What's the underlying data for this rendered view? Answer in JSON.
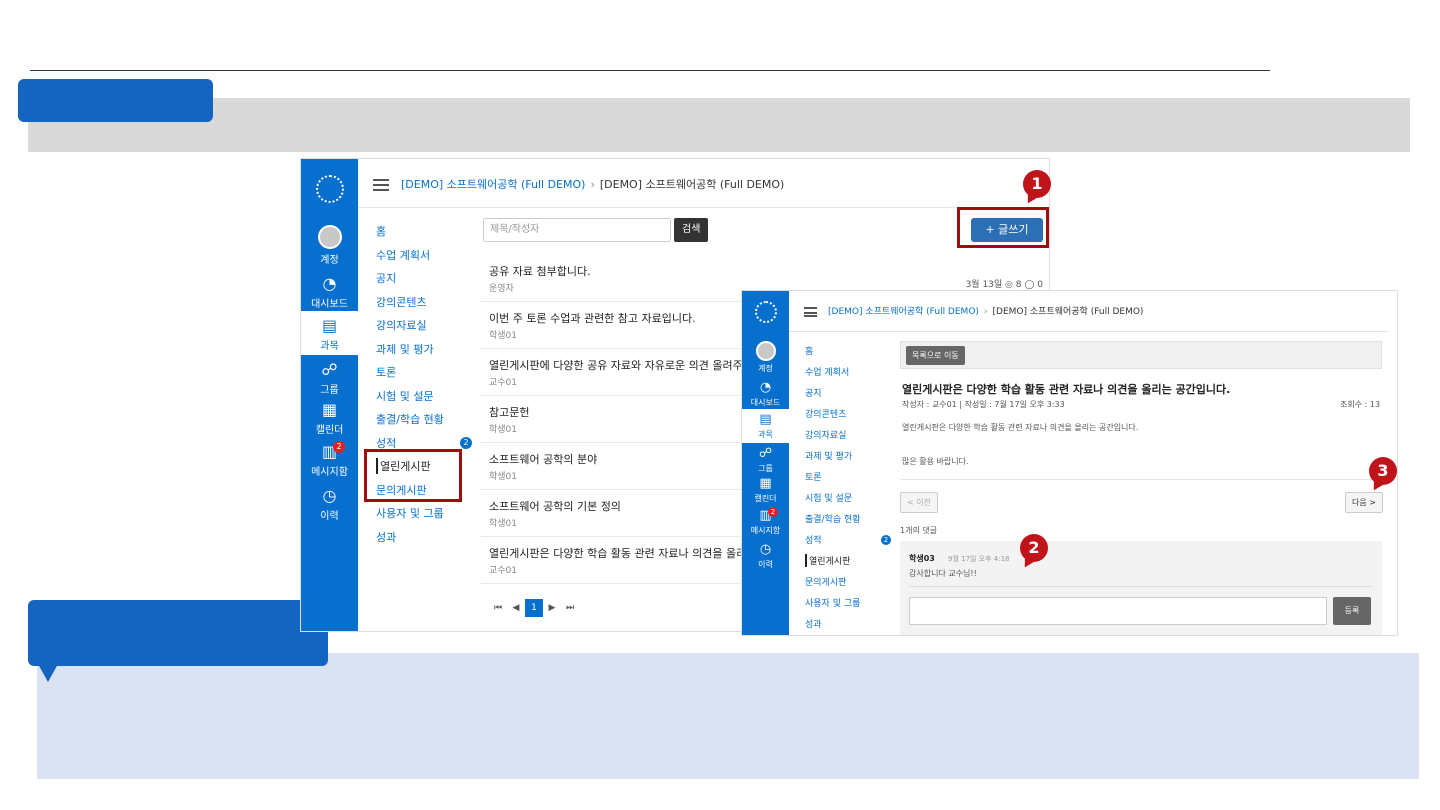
{
  "shot1": {
    "breadcrumb": [
      "[DEMO] 소프트웨어공학 (Full DEMO)",
      "[DEMO] 소프트웨어공학 (Full DEMO)"
    ],
    "global_nav": [
      {
        "label": "계정",
        "icon": "avatar-icon"
      },
      {
        "label": "대시보드",
        "icon": "dashboard-icon"
      },
      {
        "label": "과목",
        "icon": "book-icon"
      },
      {
        "label": "그룹",
        "icon": "group-icon"
      },
      {
        "label": "캘린더",
        "icon": "calendar-icon"
      },
      {
        "label": "메시지함",
        "icon": "inbox-icon",
        "badge": "2"
      },
      {
        "label": "이력",
        "icon": "clock-icon"
      }
    ],
    "course_nav": [
      "홈",
      "수업 계획서",
      "공지",
      "강의콘텐츠",
      "강의자료실",
      "과제 및 평가",
      "토론",
      "시험 및 설문",
      "출결/학습 현황",
      "성적",
      "열린게시판",
      "문의게시판",
      "사용자 및 그룹",
      "성과"
    ],
    "grades_badge": "2",
    "search_placeholder": "제목/작성자",
    "search_button": "검색",
    "write_button": "+ 글쓰기",
    "posts": [
      {
        "title": "공유 자료 첨부합니다.",
        "author": "운영자",
        "meta": "3월 13일  ◎ 8  ◯ 0"
      },
      {
        "title": "이번 주 토론 수업과 관련한 참고 자료입니다.",
        "author": "학생01",
        "meta": ""
      },
      {
        "title": "열린게시판에 다양한 공유 자료와 자유로운 의견 올려주시",
        "author": "교수01",
        "meta": ""
      },
      {
        "title": "참고문헌",
        "author": "학생01",
        "meta": ""
      },
      {
        "title": "소프트웨어 공학의 분야",
        "author": "학생01",
        "meta": ""
      },
      {
        "title": "소프트웨어 공학의 기본 정의",
        "author": "학생01",
        "meta": ""
      },
      {
        "title": "열린게시판은 다양한 학습 활동 관련 자료나 의견을 올리는",
        "author": "교수01",
        "meta": ""
      }
    ],
    "pager": [
      "⏮",
      "◀",
      "1",
      "▶",
      "⏭"
    ]
  },
  "shot2": {
    "breadcrumb": [
      "[DEMO] 소프트웨어공학 (Full DEMO)",
      "[DEMO] 소프트웨어공학 (Full DEMO)"
    ],
    "global_nav": [
      {
        "label": "계정"
      },
      {
        "label": "대시보드"
      },
      {
        "label": "과목"
      },
      {
        "label": "그룹"
      },
      {
        "label": "캘린더"
      },
      {
        "label": "메시지함",
        "badge": "2"
      },
      {
        "label": "이력"
      }
    ],
    "course_nav": [
      "홈",
      "수업 계획서",
      "공지",
      "강의콘텐츠",
      "강의자료실",
      "과제 및 평가",
      "토론",
      "시험 및 설문",
      "출결/학습 현황",
      "성적",
      "열린게시판",
      "문의게시판",
      "사용자 및 그룹",
      "성과"
    ],
    "grades_badge": "2",
    "list_button": "목록으로 이동",
    "topic_title": "열린게시판은 다양한 학습 활동 관련 자료나 의견을 올리는 공간입니다.",
    "topic_meta": "작성자 : 교수01  |  작성일 : 7월 17일 오후 3:33",
    "views": "조회수 : 13",
    "body_line1": "열린게시판은 다양한 학습 활동 관련 자료나 의견을 올리는 공간입니다.",
    "body_line2": "많은 활용 바랍니다.",
    "prev_button": "< 이전",
    "next_button": "다음 >",
    "comment_count": "1개의 댓글",
    "comment_author": "학생03",
    "comment_time": "9월 17일 오후 4:18",
    "comment_text": "감사합니다 교수님!!",
    "register_button": "등록"
  },
  "annotations": [
    "1",
    "2",
    "3"
  ],
  "colors": {
    "brand": "#0770cf",
    "annotation": "#c0141b",
    "slide_blue": "#1565c0",
    "desc_band": "#dae3f3"
  }
}
